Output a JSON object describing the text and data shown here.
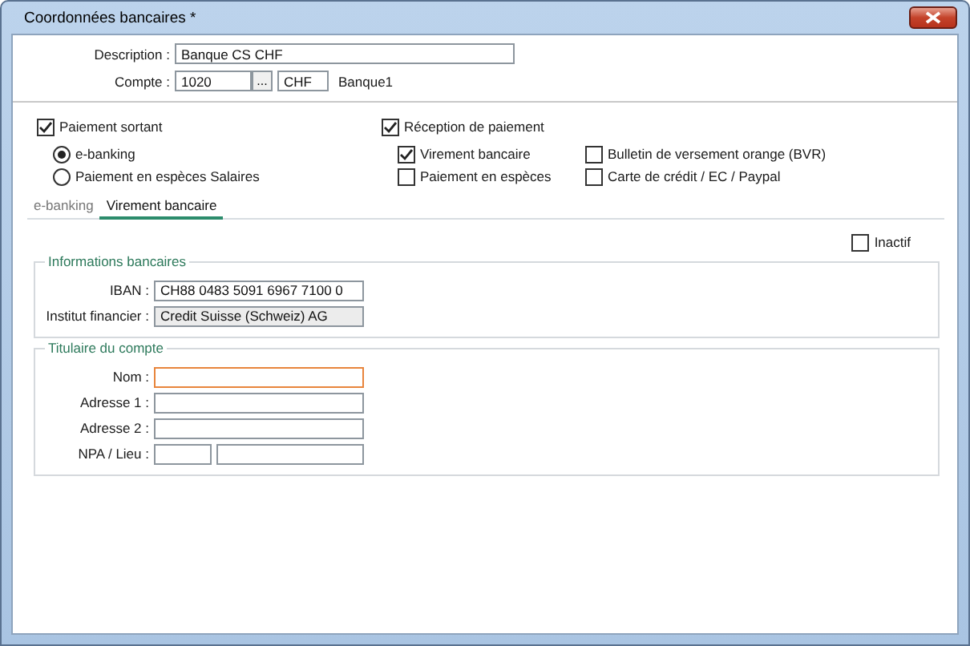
{
  "window": {
    "title": "Coordonnées bancaires *"
  },
  "description": {
    "label": "Description :",
    "value": "Banque CS CHF"
  },
  "account": {
    "label": "Compte :",
    "value": "1020",
    "browse": "...",
    "currency": "CHF",
    "name": "Banque1"
  },
  "outgoing": {
    "label": "Paiement sortant",
    "checked": true,
    "options": [
      {
        "label": "e-banking",
        "selected": true
      },
      {
        "label": "Paiement en espèces Salaires",
        "selected": false
      }
    ]
  },
  "incoming": {
    "label": "Réception de paiement",
    "checked": true,
    "options": [
      {
        "label": "Virement bancaire",
        "checked": true
      },
      {
        "label": "Paiement en espèces",
        "checked": false
      },
      {
        "label": "Bulletin de versement orange (BVR)",
        "checked": false
      },
      {
        "label": "Carte de crédit / EC / Paypal",
        "checked": false
      }
    ]
  },
  "tabs": [
    {
      "label": "e-banking",
      "selected": false
    },
    {
      "label": "Virement bancaire",
      "selected": true
    }
  ],
  "inactive": {
    "label": "Inactif",
    "checked": false
  },
  "bank_info": {
    "title": "Informations bancaires",
    "fields": [
      {
        "kind": "single",
        "label": "IBAN :",
        "value": "CH88 0483 5091 6967 7100 0",
        "readonly": false,
        "focused": false
      },
      {
        "kind": "single",
        "label": "Institut financier :",
        "value": "Credit Suisse (Schweiz) AG",
        "readonly": true,
        "focused": false
      }
    ]
  },
  "holder": {
    "title": "Titulaire du compte",
    "fields": [
      {
        "kind": "single",
        "label": "Nom :",
        "readonly": false,
        "focused": true
      },
      {
        "kind": "single",
        "label": "Adresse 1 :",
        "readonly": false,
        "focused": false
      },
      {
        "kind": "single",
        "label": "Adresse 2 :",
        "readonly": false,
        "focused": false
      },
      {
        "kind": "split",
        "label": "NPA / Lieu :",
        "readonly": false,
        "focused": false
      }
    ]
  }
}
